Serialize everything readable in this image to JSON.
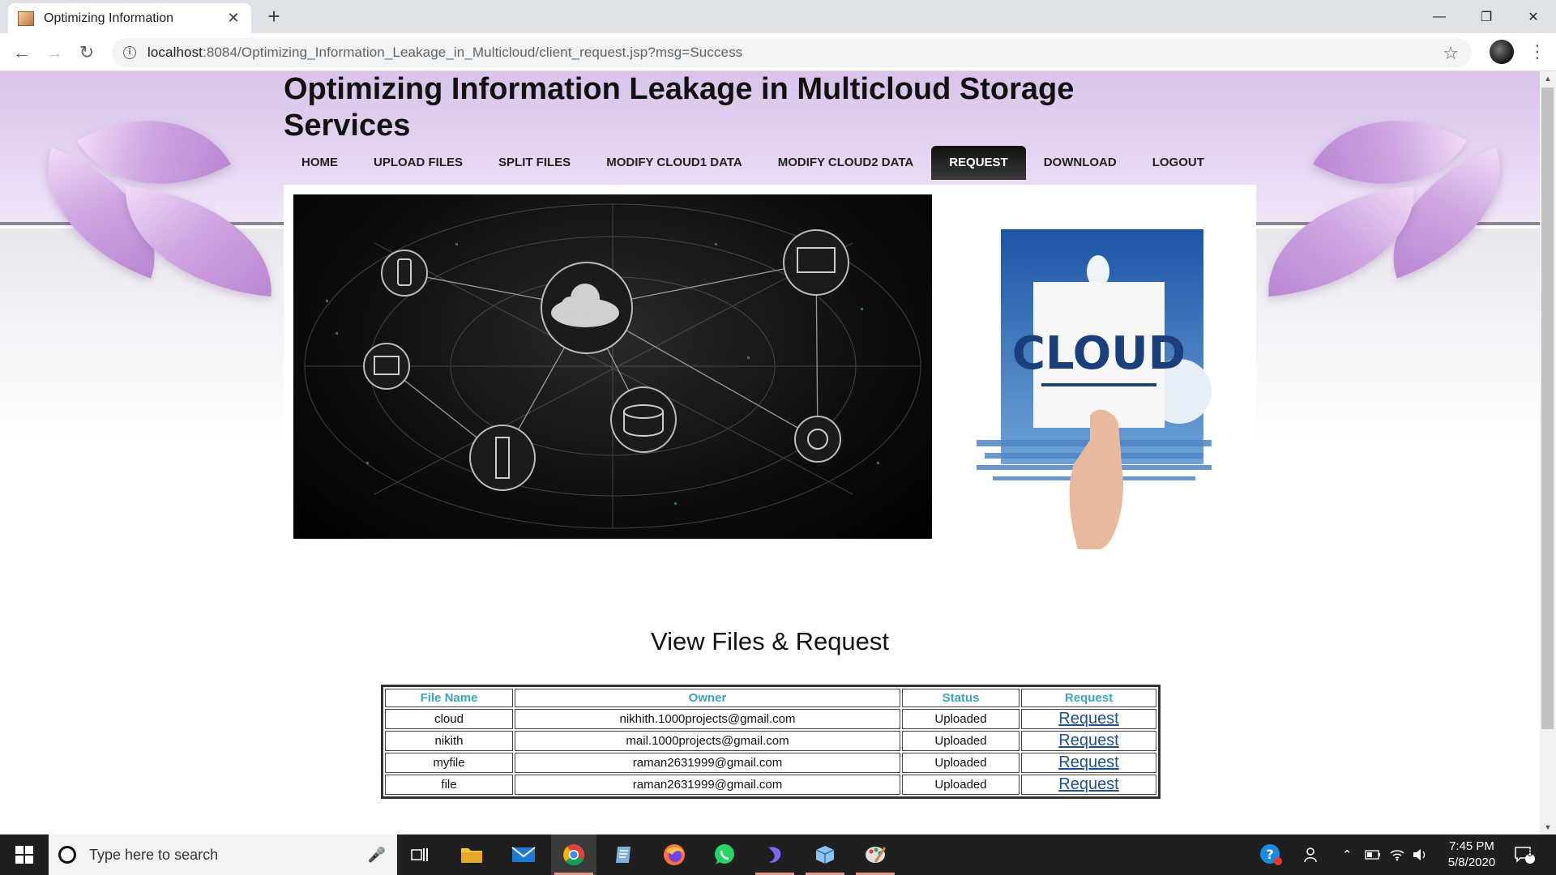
{
  "browser": {
    "tab_title": "Optimizing Information",
    "url_host": "localhost",
    "url_rest": ":8084/Optimizing_Information_Leakage_in_Multicloud/client_request.jsp?msg=Success"
  },
  "site": {
    "title": "Optimizing Information Leakage in Multicloud Storage Services",
    "menu": [
      {
        "label": "HOME",
        "active": false
      },
      {
        "label": "UPLOAD FILES",
        "active": false
      },
      {
        "label": "SPLIT FILES",
        "active": false
      },
      {
        "label": "MODIFY CLOUD1 DATA",
        "active": false
      },
      {
        "label": "MODIFY CLOUD2 DATA",
        "active": false
      },
      {
        "label": "REQUEST",
        "active": true
      },
      {
        "label": "DOWNLOAD",
        "active": false
      },
      {
        "label": "LOGOUT",
        "active": false
      }
    ],
    "cloud_card_text": "CLOUD"
  },
  "section": {
    "title": "View Files & Request"
  },
  "table": {
    "headers": [
      "File Name",
      "Owner",
      "Status",
      "Request"
    ],
    "rows": [
      {
        "file": "cloud",
        "owner": "nikhith.1000projects@gmail.com",
        "status": "Uploaded",
        "action": "Request"
      },
      {
        "file": "nikith",
        "owner": "mail.1000projects@gmail.com",
        "status": "Uploaded",
        "action": "Request"
      },
      {
        "file": "myfile",
        "owner": "raman2631999@gmail.com",
        "status": "Uploaded",
        "action": "Request"
      },
      {
        "file": "file",
        "owner": "raman2631999@gmail.com",
        "status": "Uploaded",
        "action": "Request"
      }
    ]
  },
  "taskbar": {
    "search_placeholder": "Type here to search",
    "time": "7:45 PM",
    "date": "5/8/2020",
    "notification_count": "5"
  },
  "colors": {
    "header_purple": "#d9c3ea",
    "menu_active": "#111111",
    "table_header_text": "#3ca3c5",
    "link": "#1d4f91"
  }
}
